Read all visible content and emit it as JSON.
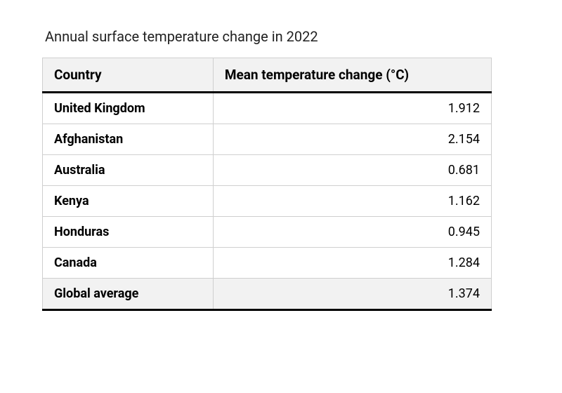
{
  "title": "Annual surface temperature change in 2022",
  "columns": {
    "country": "Country",
    "value": "Mean temperature change (°C)"
  },
  "rows": [
    {
      "country": "United Kingdom",
      "value": "1.912"
    },
    {
      "country": "Afghanistan",
      "value": "2.154"
    },
    {
      "country": "Australia",
      "value": "0.681"
    },
    {
      "country": "Kenya",
      "value": "1.162"
    },
    {
      "country": "Honduras",
      "value": "0.945"
    },
    {
      "country": "Canada",
      "value": "1.284"
    }
  ],
  "summary": {
    "label": "Global average",
    "value": "1.374"
  },
  "chart_data": {
    "type": "table",
    "title": "Annual surface temperature change in 2022",
    "columns": [
      "Country",
      "Mean temperature change (°C)"
    ],
    "rows": [
      [
        "United Kingdom",
        1.912
      ],
      [
        "Afghanistan",
        2.154
      ],
      [
        "Australia",
        0.681
      ],
      [
        "Kenya",
        1.162
      ],
      [
        "Honduras",
        0.945
      ],
      [
        "Canada",
        1.284
      ],
      [
        "Global average",
        1.374
      ]
    ]
  }
}
